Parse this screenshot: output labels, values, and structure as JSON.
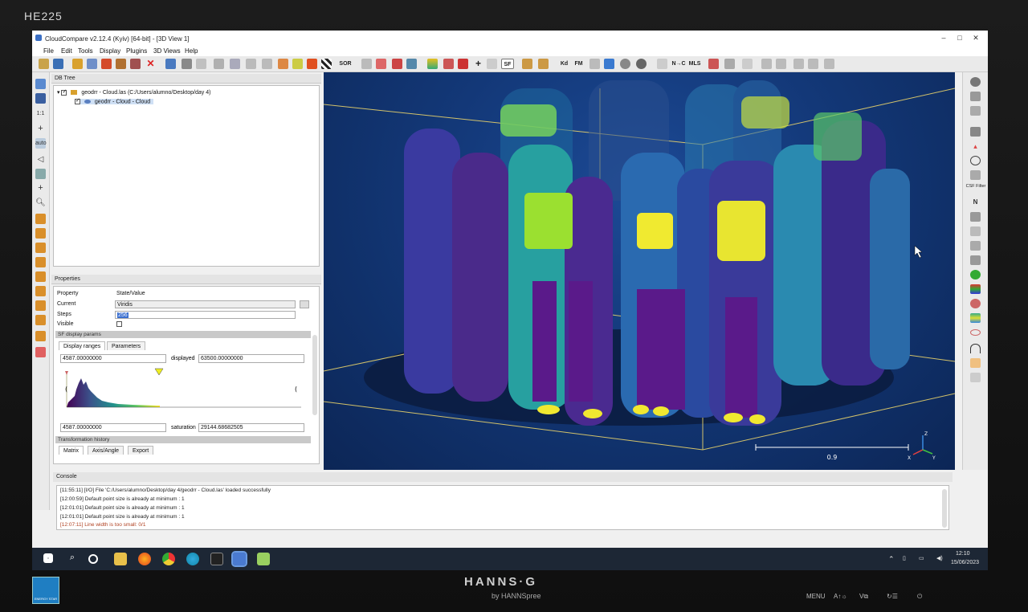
{
  "monitor": {
    "model_label": "HE225",
    "brand": "HANNS·G",
    "sub_brand": "by HANNSpree",
    "energy_star": "ENERGY STAR",
    "controls": [
      "MENU",
      "A↑☼",
      "V⧉",
      "↻☰",
      "⏻"
    ]
  },
  "window": {
    "title": "CloudCompare v2.12.4 (Kyiv) [64-bit] - [3D View 1]",
    "controls": [
      "–",
      "□",
      "✕"
    ]
  },
  "menu": [
    "File",
    "Edit",
    "Tools",
    "Display",
    "Plugins",
    "3D Views",
    "Help"
  ],
  "toolbar_icons": [
    "open-icon",
    "save-icon",
    "gear-icon",
    "list-icon",
    "add-icon",
    "merge-icon",
    "segment-icon",
    "delete-icon",
    "sample-icon",
    "normals-icon",
    "shield-icon",
    "compute-icon",
    "octree-icon",
    "translate-icon",
    "rotate-icon",
    "sf-icon",
    "cc-icon",
    "fire-icon",
    "checker-icon",
    "sor-icon"
  ],
  "toolbar_labels": {
    "sor": "SOR",
    "sf": "SF",
    "kd": "Kd",
    "fm": "FM",
    "ncc": "N→C",
    "mls": "MLS"
  },
  "left_tools": {
    "zoom_1_1": "1:1",
    "auto": "auto"
  },
  "db_tree": {
    "title": "DB Tree",
    "items": [
      {
        "label": "geodrr - Cloud.las (C:/Users/alumno/Desktop/day 4)",
        "checked": true
      },
      {
        "label": "geodrr - Cloud - Cloud",
        "checked": true
      }
    ]
  },
  "properties": {
    "title": "Properties",
    "col_property": "Property",
    "col_value": "State/Value",
    "current_label": "Current",
    "current_value": "Viridis",
    "steps_label": "Steps",
    "steps_value": "256",
    "visible_label": "Visible",
    "sf_section": "SF display params",
    "tabs": [
      "Display ranges",
      "Parameters"
    ],
    "range_min": "4587.00000000",
    "displayed_label": "displayed",
    "displayed_value": "63500.00000000",
    "sat_min": "4587.00000000",
    "saturation_label": "saturation",
    "saturation_value": "29144.68682505",
    "transformation_section": "Transformation history",
    "transform_tabs": [
      "Matrix",
      "Axis/Angle",
      "Export"
    ]
  },
  "view3d": {
    "scale_label": "0.9",
    "axis_z": "Z",
    "axis_x": "X",
    "axis_y": "Y"
  },
  "right_tools": {
    "csf_label": "CSF Filter",
    "north": "N"
  },
  "console": {
    "title": "Console",
    "lines": [
      {
        "text": "[11:55:11] [I/O] File 'C:/Users/alumno/Desktop/day 4/geodrr - Cloud.las' loaded successfully",
        "warn": false
      },
      {
        "text": "[12:00:59] Default point size is already at minimum : 1",
        "warn": false
      },
      {
        "text": "[12:01:01] Default point size is already at minimum : 1",
        "warn": false
      },
      {
        "text": "[12:01:01] Default point size is already at minimum : 1",
        "warn": false
      },
      {
        "text": "[12:07:11] Line width is too small: 0/1",
        "warn": true
      }
    ]
  },
  "taskbar": {
    "time": "12:10",
    "date": "15/06/2023"
  },
  "colors": {
    "viridis_low": "#440154",
    "viridis_mid": "#21918c",
    "viridis_high": "#fde725",
    "view_bg": "#133878",
    "taskbar": "#1d2735"
  }
}
